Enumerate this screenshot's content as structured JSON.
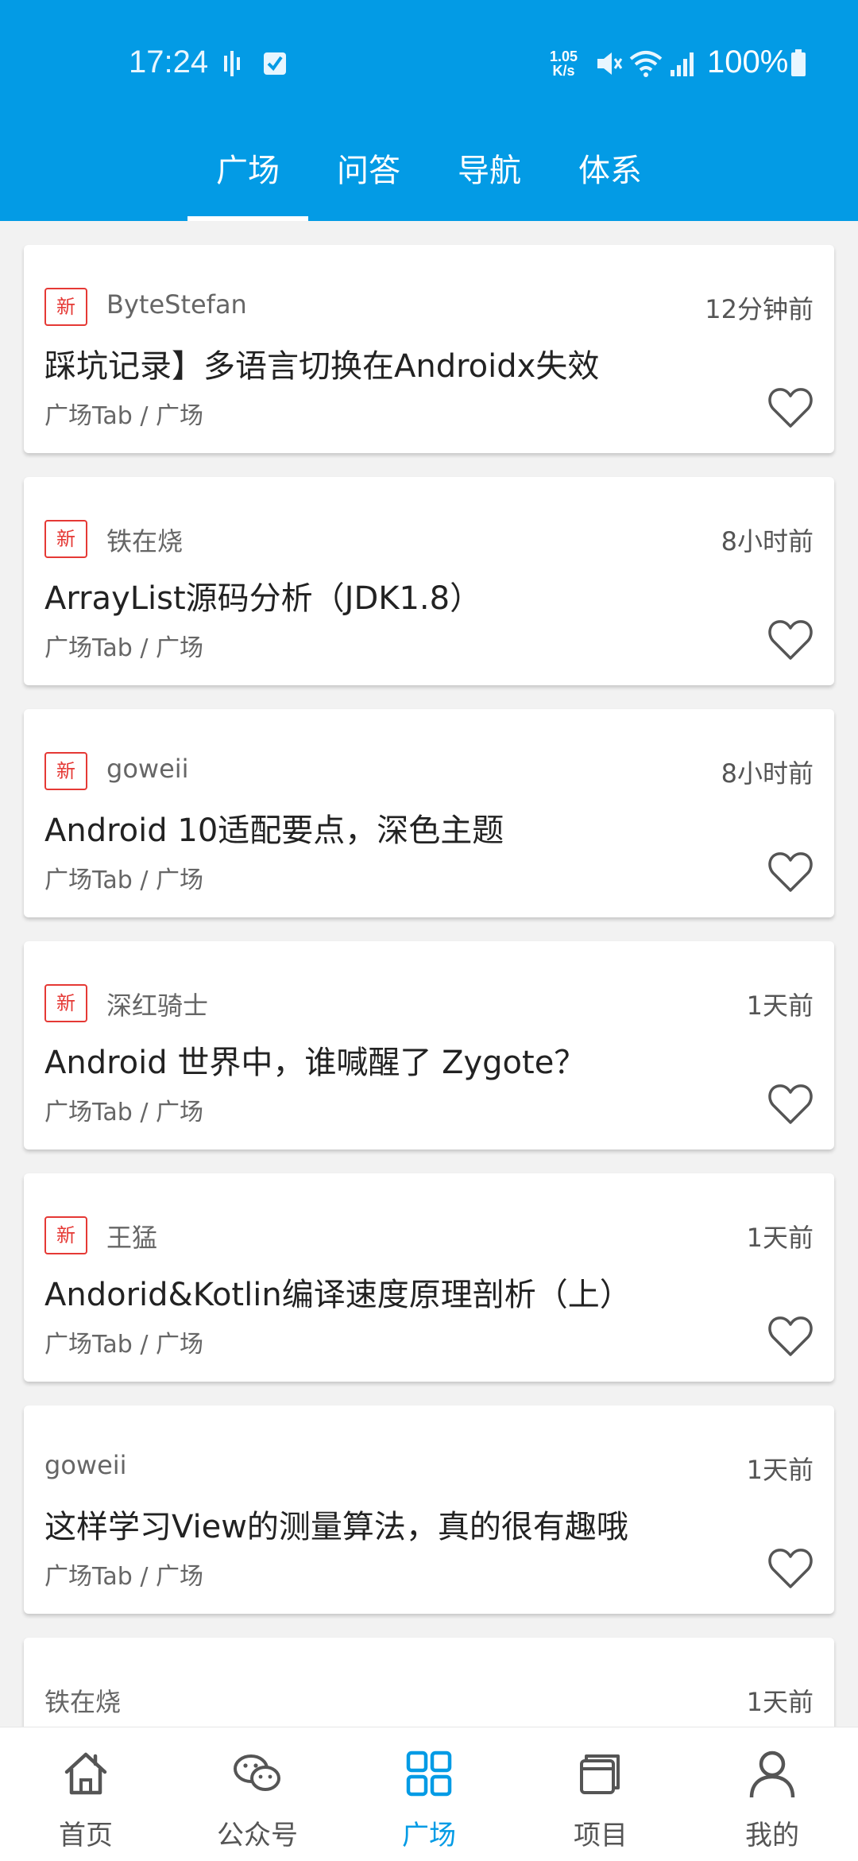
{
  "status_bar": {
    "time": "17:24",
    "net_speed_value": "1.05",
    "net_speed_unit": "K/s",
    "battery": "100%"
  },
  "top_tabs": [
    {
      "label": "广场"
    },
    {
      "label": "问答"
    },
    {
      "label": "导航"
    },
    {
      "label": "体系"
    }
  ],
  "active_tab": "广场",
  "articles": [
    {
      "is_new": true,
      "new_label": "新",
      "author": "ByteStefan",
      "time": "12分钟前",
      "title": "踩坑记录】多语言切换在Androidx失效",
      "category": "广场Tab / 广场"
    },
    {
      "is_new": true,
      "new_label": "新",
      "author": "铁在烧",
      "time": "8小时前",
      "title": "ArrayList源码分析（JDK1.8）",
      "category": "广场Tab / 广场"
    },
    {
      "is_new": true,
      "new_label": "新",
      "author": "goweii",
      "time": "8小时前",
      "title": "Android 10适配要点，深色主题",
      "category": "广场Tab / 广场"
    },
    {
      "is_new": true,
      "new_label": "新",
      "author": "深红骑士",
      "time": "1天前",
      "title": "Android 世界中，谁喊醒了 Zygote？",
      "category": "广场Tab / 广场"
    },
    {
      "is_new": true,
      "new_label": "新",
      "author": "王猛",
      "time": "1天前",
      "title": "Andorid&Kotlin编译速度原理剖析（上）",
      "category": "广场Tab / 广场"
    },
    {
      "is_new": false,
      "author": "goweii",
      "time": "1天前",
      "title": "这样学习View的测量算法，真的很有趣哦",
      "category": "广场Tab / 广场"
    },
    {
      "is_new": false,
      "author": "铁在烧",
      "time": "1天前",
      "title": "",
      "category": ""
    }
  ],
  "bottom_nav": [
    {
      "label": "首页",
      "icon": "home-icon"
    },
    {
      "label": "公众号",
      "icon": "wechat-icon"
    },
    {
      "label": "广场",
      "icon": "square-grid-icon"
    },
    {
      "label": "项目",
      "icon": "project-icon"
    },
    {
      "label": "我的",
      "icon": "profile-icon"
    }
  ],
  "colors": {
    "primary": "#039BE5",
    "new_badge": "#e53935",
    "background": "#f2f2f2"
  }
}
